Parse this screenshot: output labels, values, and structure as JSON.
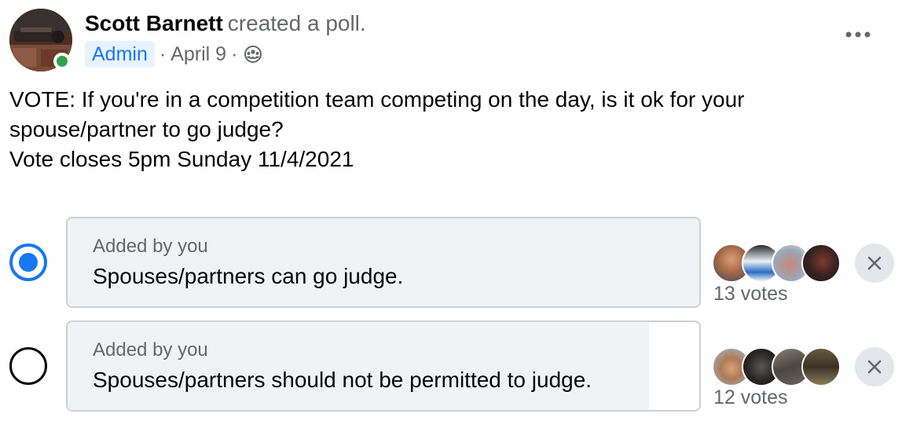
{
  "post": {
    "author_name": "Scott Barnett",
    "author_action": "created a poll.",
    "badge": "Admin",
    "separator": "·",
    "date": "April 9",
    "privacy_icon": "group-icon",
    "online": true,
    "more_icon": "ellipsis-icon"
  },
  "poll": {
    "text_lines": [
      "VOTE: If you're in a competition team competing on the day, is it ok for your",
      "spouse/partner to go judge?",
      "Vote closes 5pm Sunday 11/4/2021"
    ],
    "options": [
      {
        "added_by": "Added by you",
        "label": "Spouses/partners can go judge.",
        "votes_text": "13 votes",
        "votes": 13,
        "selected": true,
        "fill_fraction": 1.0
      },
      {
        "added_by": "Added by you",
        "label": "Spouses/partners should not be permitted to judge.",
        "votes_text": "12 votes",
        "votes": 12,
        "selected": false,
        "fill_fraction": 0.92
      }
    ]
  },
  "colors": {
    "accent": "#1877f2",
    "secondary_text": "#65676b",
    "online": "#31a24c",
    "option_fill": "#f0f2f5"
  }
}
